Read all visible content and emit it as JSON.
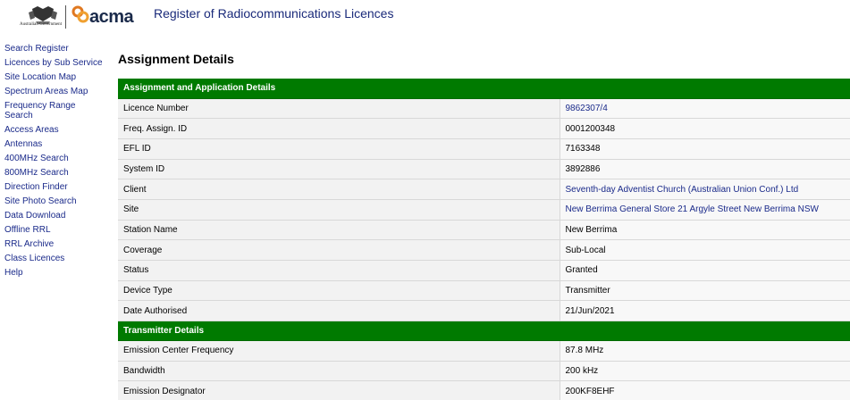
{
  "header": {
    "crest_text": "Australian Government",
    "logo_text": "acma",
    "site_title": "Register of Radiocommunications Licences"
  },
  "sidebar": {
    "items": [
      "Search Register",
      "Licences by Sub Service",
      "Site Location Map",
      "Spectrum Areas Map",
      "Frequency Range Search",
      "Access Areas",
      "Antennas",
      "400MHz Search",
      "800MHz Search",
      "Direction Finder",
      "Site Photo Search",
      "Data Download",
      "Offline RRL",
      "RRL Archive",
      "Class Licences",
      "Help"
    ]
  },
  "main": {
    "heading": "Assignment Details",
    "sections": [
      {
        "title": "Assignment and Application Details",
        "rows": [
          {
            "label": "Licence Number",
            "value": "9862307/4"
          },
          {
            "label": "Freq. Assign. ID",
            "value": "0001200348"
          },
          {
            "label": "EFL ID",
            "value": "7163348"
          },
          {
            "label": "System ID",
            "value": "3892886"
          },
          {
            "label": "Client",
            "value": "Seventh-day Adventist Church (Australian Union Conf.) Ltd"
          },
          {
            "label": "Site",
            "value": "New Berrima General Store 21 Argyle Street New Berrima NSW"
          },
          {
            "label": "Station Name",
            "value": "New Berrima"
          },
          {
            "label": "Coverage",
            "value": "Sub-Local"
          },
          {
            "label": "Status",
            "value": "Granted"
          },
          {
            "label": "Device Type",
            "value": "Transmitter"
          },
          {
            "label": "Date Authorised",
            "value": "21/Jun/2021"
          }
        ]
      },
      {
        "title": "Transmitter Details",
        "rows": [
          {
            "label": "Emission Center Frequency",
            "value": "87.8 MHz"
          },
          {
            "label": "Bandwidth",
            "value": "200 kHz"
          },
          {
            "label": "Emission Designator",
            "value": "200KF8EHF"
          }
        ]
      }
    ]
  },
  "colors": {
    "section_header_bg": "#007a00",
    "link": "#1a2a8a",
    "title": "#1a2a7a"
  }
}
